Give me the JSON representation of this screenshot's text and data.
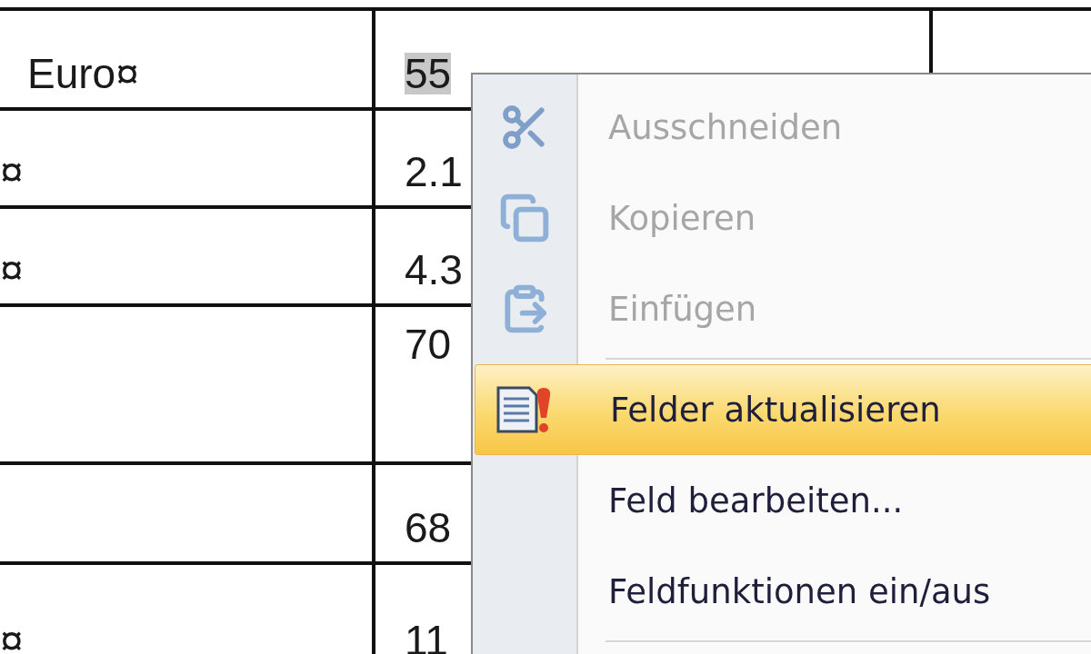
{
  "table": {
    "rows": [
      {
        "cells": [
          {
            "text": "Euro¤"
          },
          {
            "selection": "55"
          },
          {
            "text": ""
          }
        ]
      },
      {
        "cells": [
          {
            "text": "¤"
          },
          {
            "text": "2.1"
          },
          {
            "text": ""
          }
        ]
      },
      {
        "cells": [
          {
            "text": "¤"
          },
          {
            "text": "4.3"
          },
          {
            "text": ""
          }
        ]
      },
      {
        "cells": [
          {
            "text": ""
          },
          {
            "text": "70"
          },
          {
            "text": ""
          }
        ]
      },
      {
        "cells": [
          {
            "text": ""
          },
          {
            "text": "68"
          },
          {
            "text": ""
          }
        ]
      },
      {
        "cells": [
          {
            "text": "¤"
          },
          {
            "text": "11"
          },
          {
            "text": ""
          }
        ]
      }
    ]
  },
  "context_menu": {
    "items": [
      {
        "kind": "item",
        "label": "Ausschneiden",
        "disabled": true,
        "selected": false
      },
      {
        "kind": "item",
        "label": "Kopieren",
        "disabled": true,
        "selected": false
      },
      {
        "kind": "item",
        "label": "Einfügen",
        "disabled": true,
        "selected": false
      },
      {
        "kind": "separator"
      },
      {
        "kind": "item",
        "label": "Felder aktualisieren",
        "disabled": false,
        "selected": true
      },
      {
        "kind": "item",
        "label": "Feld bearbeiten...",
        "disabled": false,
        "selected": false
      },
      {
        "kind": "item",
        "label": "Feldfunktionen ein/aus",
        "disabled": false,
        "selected": false
      },
      {
        "kind": "separator"
      }
    ]
  }
}
